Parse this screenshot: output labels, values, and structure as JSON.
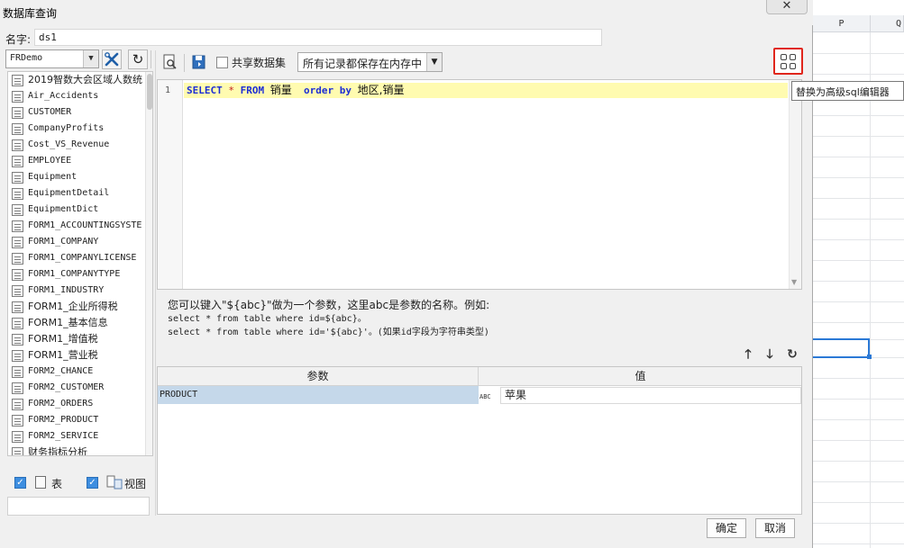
{
  "dialog": {
    "title": "数据库查询",
    "close_glyph": "✕",
    "name_label": "名字:",
    "name_value": "ds1",
    "ok_label": "确定",
    "cancel_label": "取消"
  },
  "left_panel": {
    "connection": "FRDemo",
    "tables": [
      "2019智数大会区域人数统",
      "Air_Accidents",
      "CUSTOMER",
      "CompanyProfits",
      "Cost_VS_Revenue",
      "EMPLOYEE",
      "Equipment",
      "EquipmentDetail",
      "EquipmentDict",
      "FORM1_ACCOUNTINGSYSTE",
      "FORM1_COMPANY",
      "FORM1_COMPANYLICENSE",
      "FORM1_COMPANYTYPE",
      "FORM1_INDUSTRY",
      "FORM1_企业所得税",
      "FORM1_基本信息",
      "FORM1_增值税",
      "FORM1_营业税",
      "FORM2_CHANCE",
      "FORM2_CUSTOMER",
      "FORM2_ORDERS",
      "FORM2_PRODUCT",
      "FORM2_SERVICE",
      "财务指标分析"
    ],
    "show_tables_label": "表",
    "show_views_label": "视图",
    "show_tables_checked": true,
    "show_views_checked": true
  },
  "toolbar": {
    "share_dataset_label": "共享数据集",
    "share_dataset_checked": false,
    "memory_option": "所有记录都保存在内存中",
    "advanced_sql_tooltip": "替换为高级sql编辑器"
  },
  "editor": {
    "line_number": "1",
    "sql_tokens": [
      {
        "t": "SELECT",
        "c": "kw"
      },
      {
        "t": " ",
        "c": ""
      },
      {
        "t": "*",
        "c": "op"
      },
      {
        "t": " ",
        "c": ""
      },
      {
        "t": "FROM",
        "c": "kw"
      },
      {
        "t": " ",
        "c": ""
      },
      {
        "t": "销量",
        "c": "id"
      },
      {
        "t": "  ",
        "c": ""
      },
      {
        "t": "order",
        "c": "kw"
      },
      {
        "t": " ",
        "c": ""
      },
      {
        "t": "by",
        "c": "kw"
      },
      {
        "t": " ",
        "c": ""
      },
      {
        "t": "地区,销量",
        "c": "id"
      }
    ]
  },
  "hint": {
    "line1": "您可以键入\"${abc}\"做为一个参数，这里abc是参数的名称。例如:",
    "line2": "select * from table where id=${abc}。",
    "line3": "select * from table where id='${abc}'。(如果id字段为字符串类型)"
  },
  "params": {
    "col_param": "参数",
    "col_value": "值",
    "rows": [
      {
        "name": "PRODUCT",
        "type": "ABC",
        "value": "苹果"
      }
    ]
  },
  "sheet": {
    "col_p": "P",
    "col_q": "Q"
  },
  "colors": {
    "highlight_border": "#e0261c",
    "line_highlight": "#fffbb0",
    "keyword": "#1d2ed4",
    "selected_row": "#c5d8ea"
  }
}
